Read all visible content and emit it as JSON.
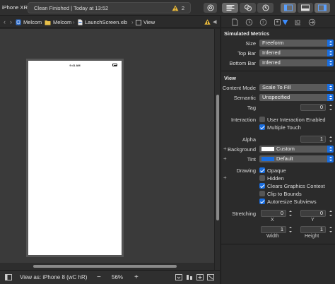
{
  "toolbar": {
    "device": "iPhone XR",
    "status_text": "Clean Finished | Today at 13:52",
    "warning_count": "2",
    "buttons": [
      "library-icon",
      "standard-editor-icon",
      "version-editor-icon",
      "assistant-icon",
      "navigator-toggle-icon",
      "debug-toggle-icon",
      "inspector-toggle-icon"
    ]
  },
  "jumpbar": {
    "crumbs": [
      "Melcom",
      "Melcom",
      "LaunchScreen.xib",
      "View"
    ]
  },
  "device_screen": {
    "time": "9:41 AM"
  },
  "bottombar": {
    "view_as": "View as: iPhone 8 (wC hR)",
    "zoom_minus": "−",
    "zoom": "56%",
    "zoom_plus": "+"
  },
  "inspector": {
    "simulated_metrics": {
      "title": "Simulated Metrics",
      "size_label": "Size",
      "size_value": "Freeform",
      "topbar_label": "Top Bar",
      "topbar_value": "Inferred",
      "bottombar_label": "Bottom Bar",
      "bottombar_value": "Inferred"
    },
    "view": {
      "title": "View",
      "content_mode_label": "Content Mode",
      "content_mode_value": "Scale To Fill",
      "semantic_label": "Semantic",
      "semantic_value": "Unspecified",
      "tag_label": "Tag",
      "tag_value": "0",
      "interaction_label": "Interaction",
      "user_interaction": "User Interaction Enabled",
      "user_interaction_checked": false,
      "multiple_touch": "Multiple Touch",
      "multiple_touch_checked": true,
      "alpha_label": "Alpha",
      "alpha_value": "1",
      "background_label": "Background",
      "background_value": "Custom",
      "background_color": "#ffffff",
      "tint_label": "Tint",
      "tint_value": "Default",
      "tint_color": "#1a6ee0",
      "drawing_label": "Drawing",
      "opaque": "Opaque",
      "opaque_checked": true,
      "hidden": "Hidden",
      "hidden_checked": false,
      "clears": "Clears Graphics Context",
      "clears_checked": true,
      "clip": "Clip to Bounds",
      "clip_checked": false,
      "autoresize": "Autoresize Subviews",
      "autoresize_checked": true,
      "stretching_label": "Stretching",
      "stretch_x_value": "0",
      "stretch_y_value": "0",
      "stretch_w_value": "1",
      "stretch_h_value": "1",
      "x_caption": "X",
      "y_caption": "Y",
      "width_caption": "Width",
      "height_caption": "Height"
    }
  }
}
